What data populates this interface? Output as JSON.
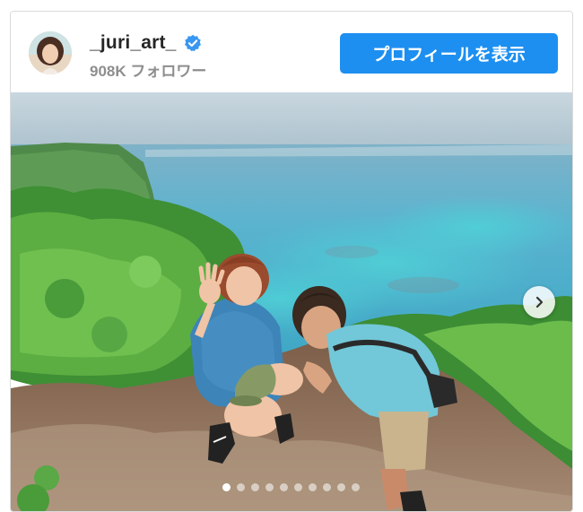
{
  "profile": {
    "username": "_juri_art_",
    "followers": "908K フォロワー",
    "view_profile_label": "プロフィールを表示",
    "verified": true
  },
  "icons": {
    "verified": "verified-badge-icon",
    "next": "chevron-right-icon"
  },
  "carousel": {
    "total_slides": 10,
    "active_index": 0
  },
  "colors": {
    "button": "#1d8ff0",
    "verified_badge": "#3897f0",
    "username": "#262626",
    "secondary_text": "#8e8e8e"
  }
}
